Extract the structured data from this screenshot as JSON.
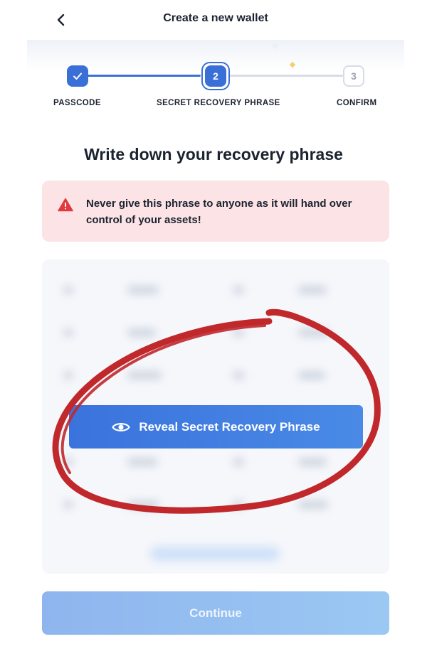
{
  "header": {
    "title": "Create a new wallet",
    "back_icon": "chevron-left-icon"
  },
  "stepper": {
    "current_step": 2,
    "steps": [
      {
        "number": "",
        "label": "PASSCODE",
        "status": "complete",
        "icon": "check-icon"
      },
      {
        "number": "2",
        "label": "SECRET RECOVERY PHRASE",
        "status": "active"
      },
      {
        "number": "3",
        "label": "CONFIRM",
        "status": "pending"
      }
    ]
  },
  "main": {
    "title": "Write down your recovery phrase",
    "warning": {
      "icon": "warning-triangle-icon",
      "text": "Never give this phrase to anyone as it will hand over control of your assets!"
    },
    "phrase_card": {
      "state": "hidden",
      "reveal_button": {
        "label": "Reveal Secret Recovery Phrase",
        "icon": "eye-icon"
      }
    },
    "continue_button": {
      "label": "Continue",
      "enabled": false
    }
  },
  "colors": {
    "accent": "#3b6fd8",
    "warning_bg": "#fbe3e6",
    "warning_icon": "#e0393e",
    "annotation_mark": "#c0282b",
    "continue_disabled": "#93bef0"
  }
}
